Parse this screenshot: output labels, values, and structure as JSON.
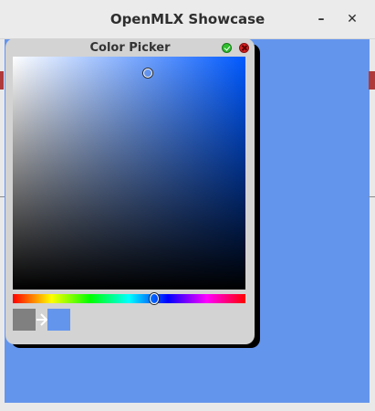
{
  "window": {
    "title": "OpenMLX Showcase",
    "minimize_label": "–",
    "close_label": "✕"
  },
  "canvas": {
    "background": "#6495ed"
  },
  "color_picker": {
    "title": "Color Picker",
    "confirm_icon": "check-circle-icon",
    "cancel_icon": "close-circle-icon",
    "hue_degrees": 219,
    "saturation": 0.58,
    "value": 0.93,
    "previous_color": "#808080",
    "new_color": "#6495ed",
    "arrow_icon": "arrow-right-icon"
  },
  "colors": {
    "confirm": "#2fbf2f",
    "cancel": "#d82020",
    "dialog_bg": "#d3d3d3"
  }
}
